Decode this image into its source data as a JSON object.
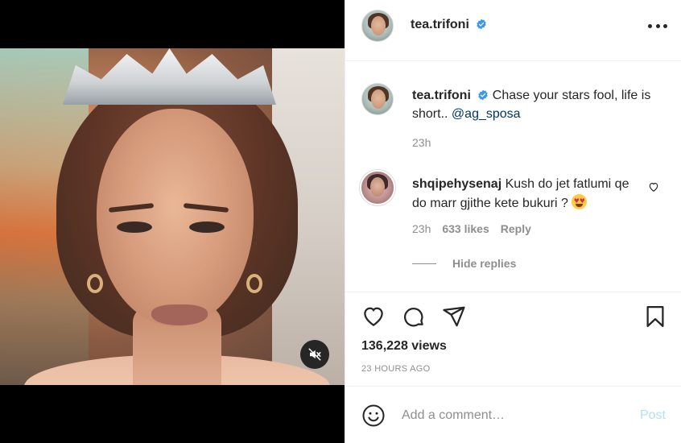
{
  "post": {
    "username": "tea.trifoni",
    "verified": true,
    "caption_text": "Chase your stars fool, life is short..",
    "caption_mention": "@ag_sposa",
    "caption_time": "23h"
  },
  "comment": {
    "username": "shqipehysenaj",
    "text": "Kush do jet fatlumi qe do marr gjithe kete bukuri ?",
    "emoji": "heart-eyes",
    "time": "23h",
    "likes": "633 likes",
    "reply_label": "Reply",
    "hide_replies_label": "Hide replies"
  },
  "stats": {
    "views": "136,228 views",
    "timestamp": "23 HOURS AGO"
  },
  "add_comment": {
    "placeholder": "Add a comment…",
    "post_label": "Post"
  },
  "colors": {
    "accent_blue": "#0095f6",
    "verified_blue": "#3897f0",
    "post_disabled": "#b2dffc",
    "muted_text": "#8e8e8e",
    "mention": "#00376b"
  },
  "icons": [
    "verified-icon",
    "more-options-icon",
    "heart-icon",
    "comment-icon",
    "share-icon",
    "save-icon",
    "smiley-icon",
    "mute-icon"
  ]
}
